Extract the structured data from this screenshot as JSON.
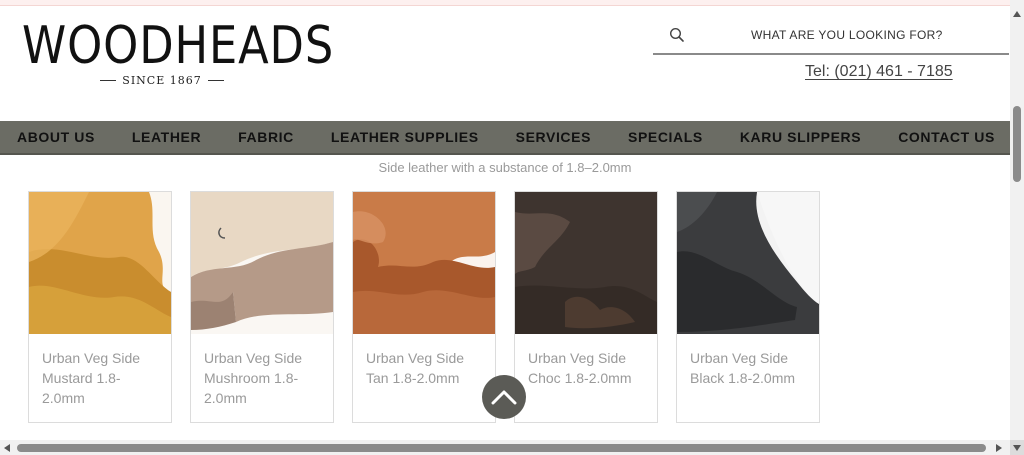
{
  "header": {
    "logo_text": "WOODHEADS",
    "logo_since": "SINCE 1867",
    "search_placeholder": "WHAT ARE YOU LOOKING FOR?",
    "phone": "Tel: (021) 461 - 7185"
  },
  "nav": {
    "items": [
      "ABOUT US",
      "LEATHER",
      "FABRIC",
      "LEATHER SUPPLIES",
      "SERVICES",
      "SPECIALS",
      "KARU SLIPPERS",
      "CONTACT US"
    ]
  },
  "main": {
    "subtitle": "Side leather with a substance of 1.8–2.0mm",
    "products": [
      {
        "title": "Urban Veg Side Mustard 1.8-2.0mm",
        "color": "#d99a3e"
      },
      {
        "title": "Urban Veg Side Mushroom 1.8-2.0mm",
        "color": "#d6c2ad"
      },
      {
        "title": "Urban Veg Side Tan 1.8-2.0mm",
        "color": "#b56a3c"
      },
      {
        "title": "Urban Veg Side Choc 1.8-2.0mm",
        "color": "#4a3d37"
      },
      {
        "title": "Urban Veg Side Black 1.8-2.0mm",
        "color": "#3a3b3d"
      }
    ]
  },
  "icons": {
    "search": "search-icon",
    "back_to_top": "chevron-up-icon"
  },
  "colors": {
    "nav_bg": "#6b6c64",
    "back_to_top_bg": "#5b5b56",
    "muted_text": "#9a9a9a"
  }
}
